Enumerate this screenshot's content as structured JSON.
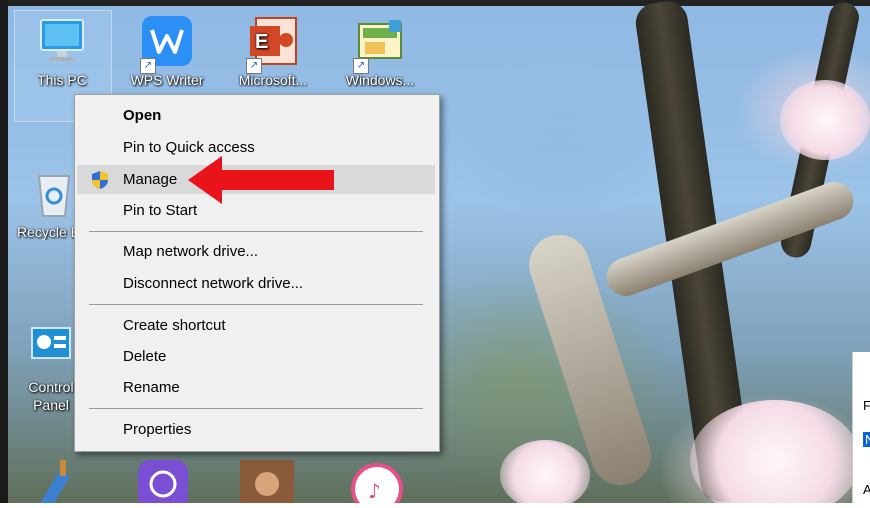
{
  "desktop_icons": [
    {
      "id": "this-pc",
      "label": "This PC",
      "shortcut": false
    },
    {
      "id": "wps-writer",
      "label": "WPS Writer",
      "shortcut": true
    },
    {
      "id": "ms-office",
      "label": "Microsoft...",
      "shortcut": true
    },
    {
      "id": "windows",
      "label": "Windows...",
      "shortcut": true
    },
    {
      "id": "recycle-bin",
      "label": "Recycle Bin",
      "shortcut": false
    },
    {
      "id": "control-panel",
      "label": "Control Panel",
      "shortcut": false
    }
  ],
  "context_menu": {
    "items": [
      {
        "label": "Open",
        "bold": true
      },
      {
        "label": "Pin to Quick access"
      },
      {
        "label": "Manage",
        "icon": "uac-shield-icon",
        "highlighted": true
      },
      {
        "label": "Pin to Start"
      },
      {
        "label": "Map network drive..."
      },
      {
        "label": "Disconnect network drive..."
      },
      {
        "label": "Create shortcut"
      },
      {
        "label": "Delete"
      },
      {
        "label": "Rename"
      },
      {
        "label": "Properties"
      }
    ]
  },
  "annotation": {
    "type": "red-arrow",
    "points_to": "Manage",
    "color": "#e8141a"
  },
  "peek_window": {
    "lines": [
      "F",
      "N",
      "A"
    ]
  },
  "colors": {
    "menu_bg": "#f0f0f0",
    "highlight": "#d9d9d9",
    "arrow": "#e8141a"
  }
}
